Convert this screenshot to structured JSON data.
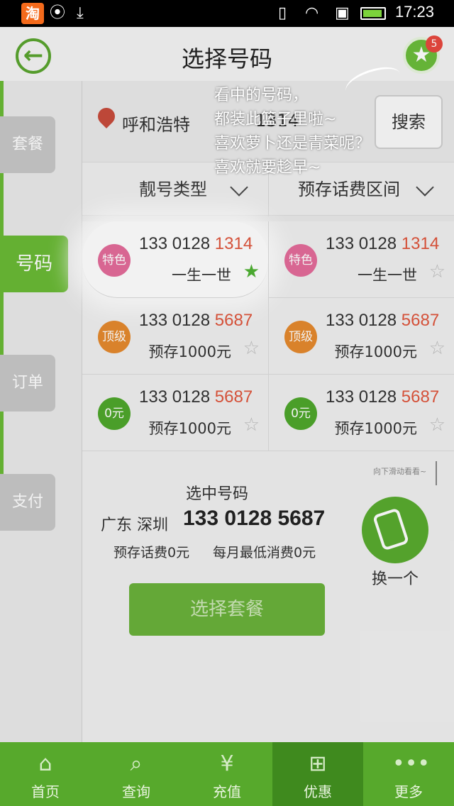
{
  "status_bar": {
    "time": "17:23",
    "app_badge": "淘"
  },
  "header": {
    "title": "选择号码",
    "cart_count": "5"
  },
  "rail": {
    "tabs": [
      "套餐",
      "号码",
      "订单",
      "支付"
    ]
  },
  "search": {
    "city": "呼和浩特",
    "query": "1314",
    "button": "搜索"
  },
  "filters": {
    "type": "靓号类型",
    "range": "预存话费区间"
  },
  "numbers": [
    {
      "badge": "特色",
      "badge_color": "#e46c9a",
      "prefix": "133 0128 ",
      "tail": "1314",
      "sub": "一生一世",
      "starred": true
    },
    {
      "badge": "特色",
      "badge_color": "#e46c9a",
      "prefix": "133 0128 ",
      "tail": "1314",
      "sub": "一生一世",
      "starred": false
    },
    {
      "badge": "顶级",
      "badge_color": "#e58a2e",
      "prefix": "133 0128 ",
      "tail": "5687",
      "sub": "预存1000元",
      "starred": false
    },
    {
      "badge": "顶级",
      "badge_color": "#e58a2e",
      "prefix": "133 0128 ",
      "tail": "5687",
      "sub": "预存1000元",
      "starred": false
    },
    {
      "badge": "0元",
      "badge_color": "#4ea72c",
      "prefix": "133 0128 ",
      "tail": "5687",
      "sub": "预存1000元",
      "starred": false
    },
    {
      "badge": "0元",
      "badge_color": "#4ea72c",
      "prefix": "133 0128 ",
      "tail": "5687",
      "sub": "预存1000元",
      "starred": false
    }
  ],
  "scroll_hint": "向下滑动看看~",
  "selected": {
    "label": "选中号码",
    "region": "广东 深圳",
    "number": "133 0128 5687",
    "prepaid": "预存话费0元",
    "min_spend": "每月最低消费0元",
    "swap_label": "换一个",
    "select_plan": "选择套餐"
  },
  "hint": {
    "line1": "看中的号码，",
    "line2": "都装此篮子里啦~",
    "line3": "喜欢萝卜还是青菜呢？",
    "line4": "喜欢就要趁早~"
  },
  "bottom_nav": [
    {
      "label": "首页",
      "icon": "home-icon",
      "glyph": "⌂"
    },
    {
      "label": "查询",
      "icon": "search-icon",
      "glyph": "⌕"
    },
    {
      "label": "充值",
      "icon": "yuan-icon",
      "glyph": "¥"
    },
    {
      "label": "优惠",
      "icon": "discount-icon",
      "glyph": "⊞"
    },
    {
      "label": "更多",
      "icon": "more-icon",
      "glyph": "•••"
    }
  ],
  "active_nav": "优惠"
}
